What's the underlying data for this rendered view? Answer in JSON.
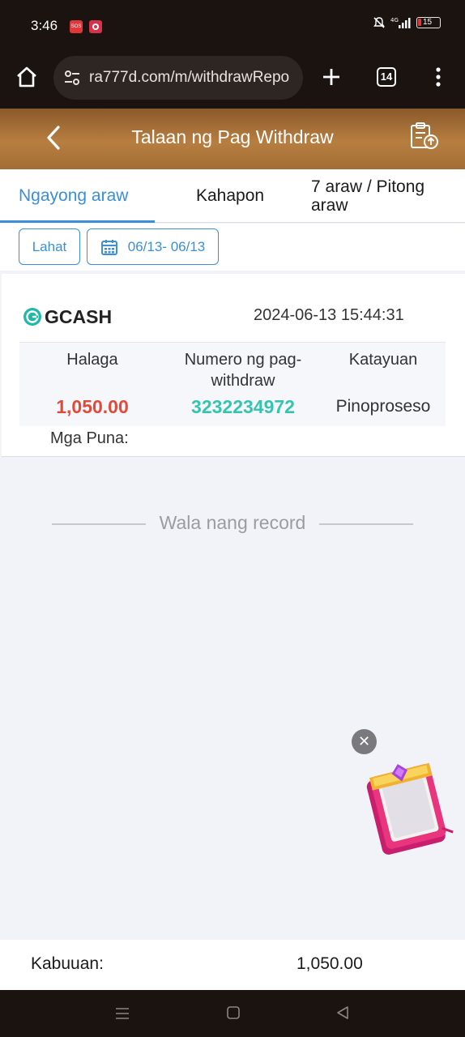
{
  "status_bar": {
    "time": "3:46",
    "battery_level": "15",
    "icons": [
      "sos-app-icon",
      "game-app-icon",
      "mute-icon",
      "signal-4g-icon",
      "battery-icon"
    ]
  },
  "browser": {
    "url": "ra777d.com/m/withdrawRepo",
    "tab_count": "14"
  },
  "header": {
    "title": "Talaan ng Pag Withdraw"
  },
  "tabs": [
    {
      "label": "Ngayong araw",
      "active": true
    },
    {
      "label": "Kahapon",
      "active": false
    },
    {
      "label_line1": "7 araw / Pitong",
      "label_line2": "araw",
      "active": false
    }
  ],
  "filters": {
    "type_label": "Lahat",
    "date_range": "06/13- 06/13"
  },
  "record": {
    "method": "GCASH",
    "datetime": "2024-06-13 15:44:31",
    "headers": {
      "amount": "Halaga",
      "number_line1": "Numero ng pag-",
      "number_line2": "withdraw",
      "status": "Katayuan"
    },
    "amount": "1,050.00",
    "withdraw_number": "3232234972",
    "status": "Pinoproseso",
    "remarks_label": "Mga Puna:"
  },
  "no_record_text": "Wala nang record",
  "footer": {
    "total_label": "Kabuuan:",
    "total_value": "1,050.00"
  },
  "colors": {
    "accent": "#3a8fd8",
    "amount": "#e04a3a",
    "withdraw_number": "#35c4b0",
    "header_gold": "#b77e40"
  }
}
